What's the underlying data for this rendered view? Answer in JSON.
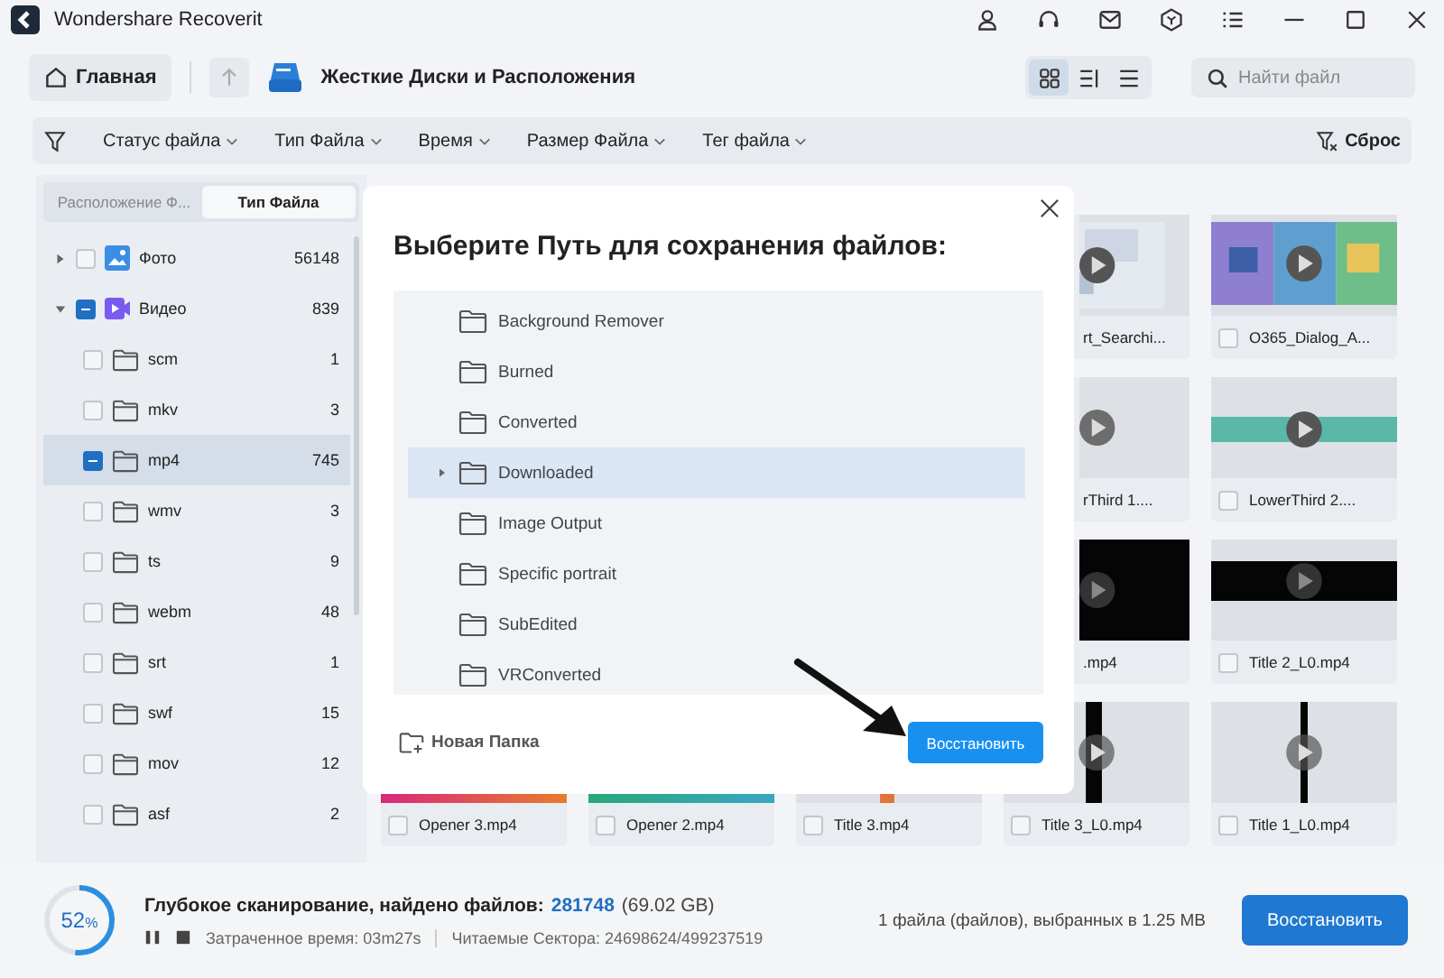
{
  "window": {
    "title": "Wondershare Recoverit"
  },
  "toolbar": {
    "home": "Главная",
    "location": "Жесткие Диски и Расположения",
    "view_modes": [
      {
        "kind": "grid",
        "selected": true
      },
      {
        "kind": "details",
        "selected": false
      },
      {
        "kind": "list",
        "selected": false
      }
    ],
    "search": {
      "placeholder": "Найти файл"
    }
  },
  "filters": {
    "items": [
      "Статус файла",
      "Тип Файла",
      "Время",
      "Размер Файла",
      "Тег файла"
    ],
    "reset": "Сброс"
  },
  "sidebar": {
    "tabs": [
      {
        "label": "Расположение Ф...",
        "selected": false
      },
      {
        "label": "Тип Файла",
        "selected": true
      }
    ],
    "tree": [
      {
        "label": "Фото",
        "count": "56148",
        "kind": "photo",
        "expanded": false,
        "partial": false,
        "selected": false
      },
      {
        "label": "Видео",
        "count": "839",
        "kind": "video",
        "expanded": true,
        "partial": true,
        "selected": false,
        "children": [
          {
            "label": "scm",
            "count": "1",
            "partial": false,
            "selected": false
          },
          {
            "label": "mkv",
            "count": "3",
            "partial": false,
            "selected": false
          },
          {
            "label": "mp4",
            "count": "745",
            "partial": true,
            "selected": true
          },
          {
            "label": "wmv",
            "count": "3",
            "partial": false,
            "selected": false
          },
          {
            "label": "ts",
            "count": "9",
            "partial": false,
            "selected": false
          },
          {
            "label": "webm",
            "count": "48",
            "partial": false,
            "selected": false
          },
          {
            "label": "srt",
            "count": "1",
            "partial": false,
            "selected": false
          },
          {
            "label": "swf",
            "count": "15",
            "partial": false,
            "selected": false
          },
          {
            "label": "mov",
            "count": "12",
            "partial": false,
            "selected": false
          },
          {
            "label": "asf",
            "count": "2",
            "partial": false,
            "selected": false
          }
        ]
      }
    ]
  },
  "grid": {
    "rows": [
      [
        null,
        null,
        null,
        {
          "name": "rt_Searchi...",
          "kind": "illustration"
        },
        {
          "name": "O365_Dialog_A...",
          "kind": "colorful",
          "checked": false
        }
      ],
      [
        null,
        null,
        null,
        {
          "name": "rThird 1....",
          "kind": "plain"
        },
        {
          "name": "LowerThird 2....",
          "kind": "band",
          "checked": false
        }
      ],
      [
        null,
        null,
        null,
        {
          "name": ".mp4",
          "kind": "dark"
        },
        {
          "name": "Title 2_L0.mp4",
          "kind": "darkband",
          "checked": false
        }
      ],
      [
        {
          "name": "Opener 3.mp4",
          "kind": "opener",
          "checked": false
        },
        {
          "name": "Opener 2.mp4",
          "kind": "opener2",
          "checked": false
        },
        {
          "name": "Title 3.mp4",
          "kind": "title",
          "checked": false
        },
        {
          "name": "Title 3_L0.mp4",
          "kind": "thick",
          "checked": false
        },
        {
          "name": "Title 1_L0.mp4",
          "kind": "thin",
          "checked": false
        }
      ]
    ]
  },
  "dialog": {
    "title": "Выберите Путь для сохранения файлов:",
    "folders": [
      {
        "label": "Background Remover",
        "selected": false,
        "has_children": false
      },
      {
        "label": "Burned",
        "selected": false,
        "has_children": false
      },
      {
        "label": "Converted",
        "selected": false,
        "has_children": false
      },
      {
        "label": "Downloaded",
        "selected": true,
        "has_children": true
      },
      {
        "label": "Image Output",
        "selected": false,
        "has_children": false
      },
      {
        "label": "Specific portrait",
        "selected": false,
        "has_children": false
      },
      {
        "label": "SubEdited",
        "selected": false,
        "has_children": false
      },
      {
        "label": "VRConverted",
        "selected": false,
        "has_children": false
      }
    ],
    "new_folder": "Новая Папка",
    "confirm": "Восстановить"
  },
  "status": {
    "percent": "52",
    "percent_sign": "%",
    "level": 0.52,
    "title": "Глубокое сканирование, найдено файлов:",
    "found": "281748",
    "size": "(69.02 GB)",
    "elapsed": "Затраченное время: 03m27s",
    "sectors": "Читаемые Сектора: 24698624/499237519",
    "selection": "1 файла (файлов), выбранных в 1.25 MB",
    "recover": "Восстановить"
  }
}
